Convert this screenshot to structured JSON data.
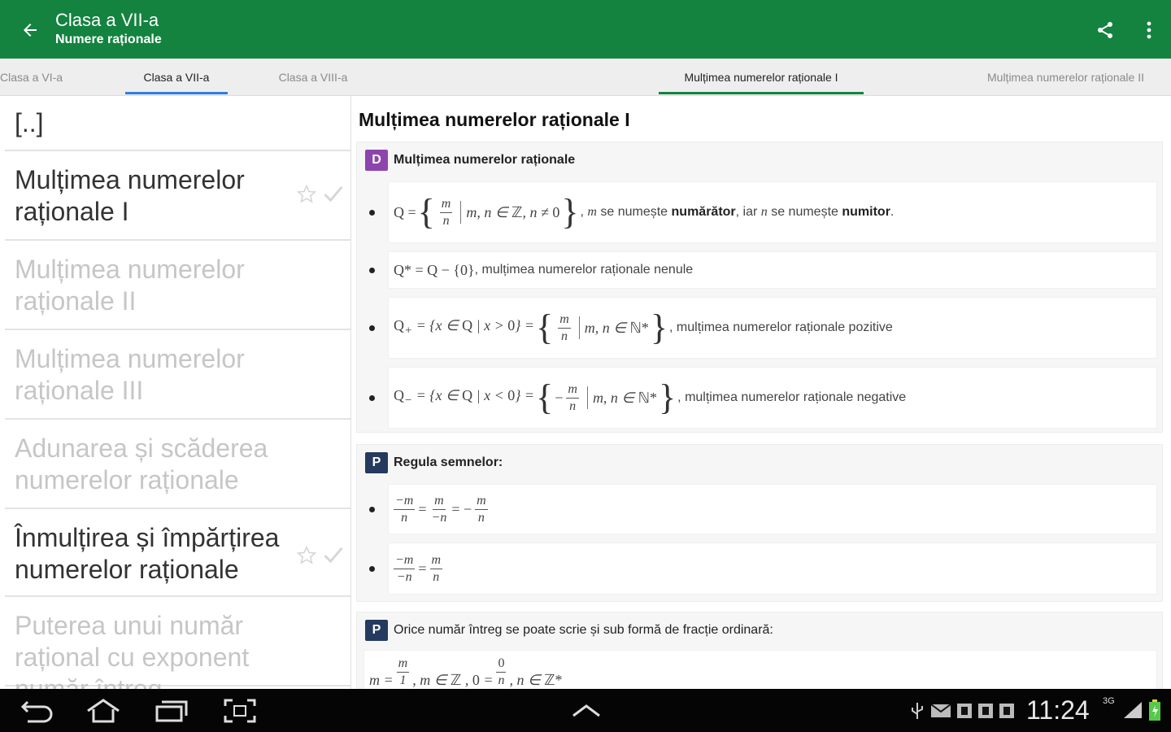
{
  "app": {
    "title": "Clasa a VII-a",
    "subtitle": "Numere raționale",
    "accent": "#13833f"
  },
  "class_tabs": [
    {
      "label": "Clasa a VI-a",
      "active": false
    },
    {
      "label": "Clasa a VII-a",
      "active": true,
      "indicator": "#2f7fe0"
    },
    {
      "label": "Clasa a VIII-a",
      "active": false
    }
  ],
  "lesson_tabs": [
    {
      "label": "Mulțimea numerelor raționale I",
      "active": true,
      "indicator": "#13833f"
    },
    {
      "label": "Mulțimea numerelor raționale II",
      "active": false
    }
  ],
  "lessons": [
    {
      "label": "[..]",
      "enabled": true
    },
    {
      "label": "Mulțimea numerelor raționale I",
      "enabled": true,
      "icons": true
    },
    {
      "label": "Mulțimea numerelor raționale II",
      "enabled": false
    },
    {
      "label": "Mulțimea numerelor raționale III",
      "enabled": false
    },
    {
      "label": "Adunarea și scăderea numerelor raționale",
      "enabled": false
    },
    {
      "label": "Înmulțirea și împărțirea numerelor raționale",
      "enabled": true,
      "icons": true
    },
    {
      "label": "Puterea unui număr rațional cu exponent număr întreg",
      "enabled": false
    }
  ],
  "content": {
    "title": "Mulțimea numerelor raționale I",
    "definition": {
      "badge": "D",
      "badge_color": "#8e44ad",
      "heading": "Mulțimea numerelor raționale",
      "rows": [
        {
          "text_prefix": ", ",
          "m": "m",
          "t1": " se numește ",
          "b1": "numărător",
          "t2": ", iar ",
          "n": "n",
          "t3": " se numește ",
          "b2": "numitor",
          "t4": "."
        },
        {
          "text": ", mulțimea numerelor raționale nenule"
        },
        {
          "text": ", mulțimea numerelor raționale pozitive"
        },
        {
          "text": ", mulțimea numerelor raționale negative"
        }
      ]
    },
    "property1": {
      "badge": "P",
      "badge_color": "#243a5e",
      "heading": "Regula semnelor:"
    },
    "property2": {
      "badge": "P",
      "badge_color": "#243a5e",
      "heading": "Orice număr întreg se poate scrie și sub formă de fracție ordinară:"
    }
  },
  "status": {
    "time": "11:24",
    "network": "3G"
  }
}
